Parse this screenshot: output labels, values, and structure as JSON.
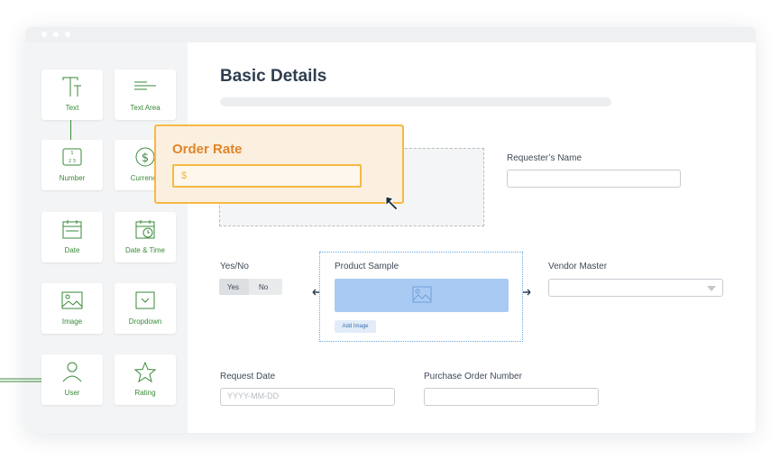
{
  "window": {
    "dots": 3
  },
  "sidebar": {
    "items": [
      {
        "label": "Text",
        "icon": "text-icon"
      },
      {
        "label": "Text Area",
        "icon": "text-area-icon"
      },
      {
        "label": "Number",
        "icon": "number-icon"
      },
      {
        "label": "Currency",
        "icon": "currency-icon"
      },
      {
        "label": "Date",
        "icon": "calendar-icon"
      },
      {
        "label": "Date & Time",
        "icon": "calendar-clock-icon"
      },
      {
        "label": "Image",
        "icon": "image-icon"
      },
      {
        "label": "Dropdown",
        "icon": "dropdown-icon"
      },
      {
        "label": "User",
        "icon": "user-icon"
      },
      {
        "label": "Rating",
        "icon": "star-icon"
      }
    ]
  },
  "form": {
    "title": "Basic Details",
    "requester_name_label": "Requester’s Name",
    "yes_no_label": "Yes/No",
    "yes": "Yes",
    "no": "No",
    "product_sample_label": "Product Sample",
    "add_image": "Add Image",
    "vendor_master_label": "Vendor Master",
    "request_date_label": "Request Date",
    "request_date_placeholder": "YYYY-MM-DD",
    "po_number_label": "Purchase Order Number"
  },
  "popup": {
    "title": "Order Rate",
    "currency_symbol": "$"
  },
  "colors": {
    "accent_green": "#3a8a3a",
    "popup_border": "#f5b945",
    "popup_title": "#e0862a",
    "image_fill": "#a9cbf3"
  }
}
